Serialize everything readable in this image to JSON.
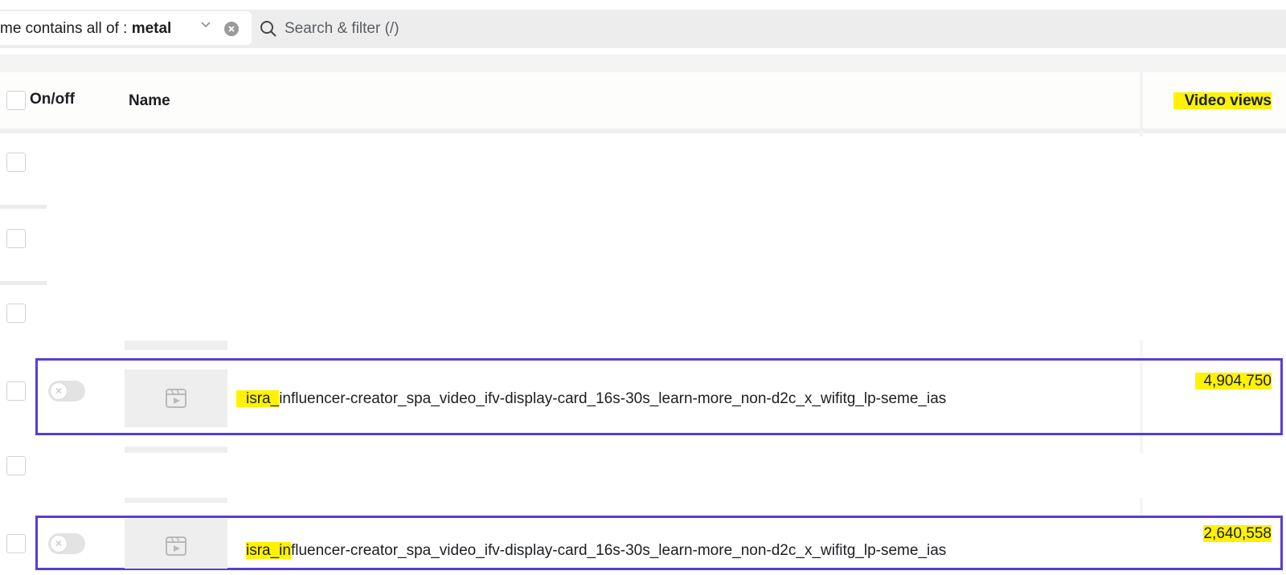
{
  "filter": {
    "chip_prefix": "me contains all of : ",
    "chip_value": "metal",
    "search_placeholder": "Search & filter (/)"
  },
  "table": {
    "columns": {
      "onoff": "On/off",
      "name": "Name",
      "views": "Video views"
    },
    "rows": [
      {
        "name_highlight": "isra_",
        "name_rest": "influencer-creator_spa_video_ifv-display-card_16s-30s_learn-more_non-d2c_x_wifitg_lp-seme_ias",
        "video_views": "4,904,750",
        "toggle_on": false
      },
      {
        "name_highlight": "isra_in",
        "name_rest": "fluencer-creator_spa_video_ifv-display-card_16s-30s_learn-more_non-d2c_x_wifitg_lp-seme_ias",
        "video_views": "2,640,558",
        "toggle_on": false
      }
    ]
  },
  "colors": {
    "highlight": "#fff200",
    "row_outline": "#5b3cd6",
    "filter_bar": "#ededed"
  },
  "icons": [
    "chevron-down-icon",
    "clear-icon",
    "search-icon",
    "video-icon",
    "toggle-off-icon"
  ]
}
